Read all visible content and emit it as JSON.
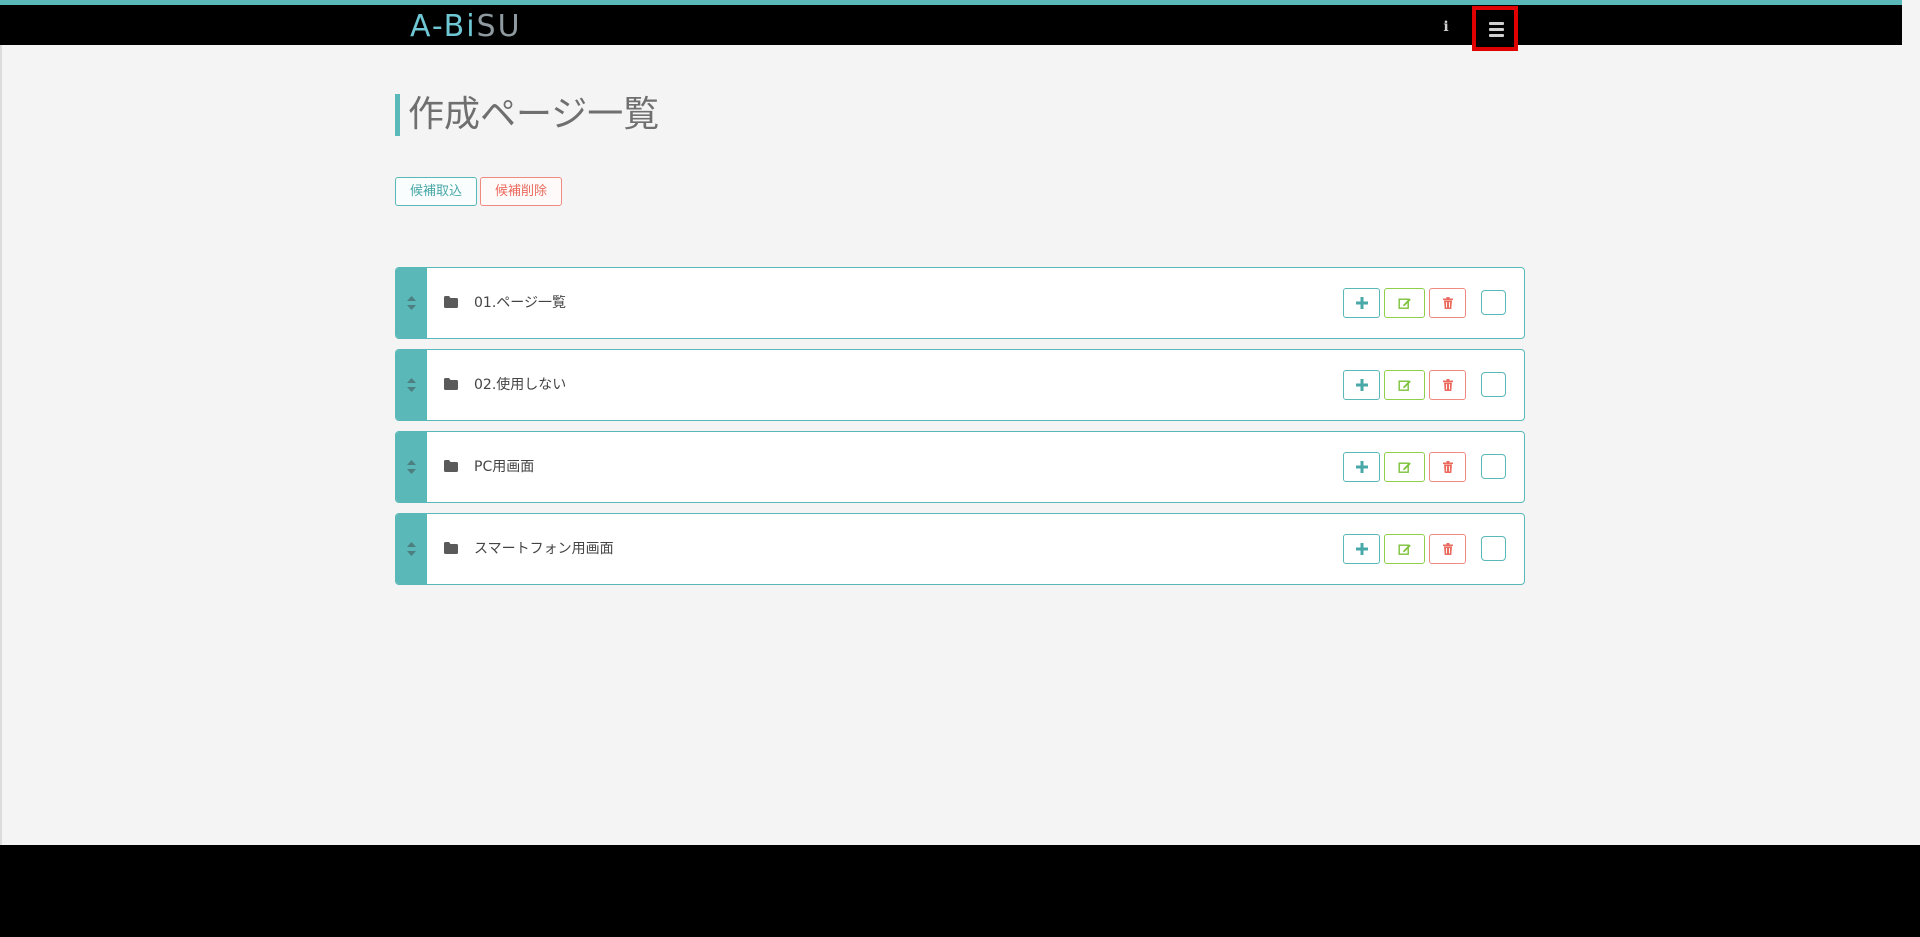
{
  "header": {
    "logo_main": "A-Bi",
    "logo_tail": "SU",
    "info_glyph": "i",
    "menu_icon": "hamburger-menu-icon"
  },
  "page": {
    "title": "作成ページ一覧"
  },
  "toolbar": {
    "import_label": "候補取込",
    "delete_label": "候補削除"
  },
  "colors": {
    "accent": "#5ab8b8",
    "edit": "#8fcf4a",
    "danger": "#ea6a5d",
    "highlight": "#e00000"
  },
  "rows": [
    {
      "label": "01.ページ一覧",
      "icon": "folder-icon"
    },
    {
      "label": "02.使用しない",
      "icon": "folder-icon"
    },
    {
      "label": "PC用画面",
      "icon": "folder-icon"
    },
    {
      "label": "スマートフォン用画面",
      "icon": "folder-icon"
    }
  ],
  "row_actions": {
    "add_icon": "plus-icon",
    "edit_icon": "edit-icon",
    "delete_icon": "trash-icon",
    "select_icon": "checkbox"
  }
}
